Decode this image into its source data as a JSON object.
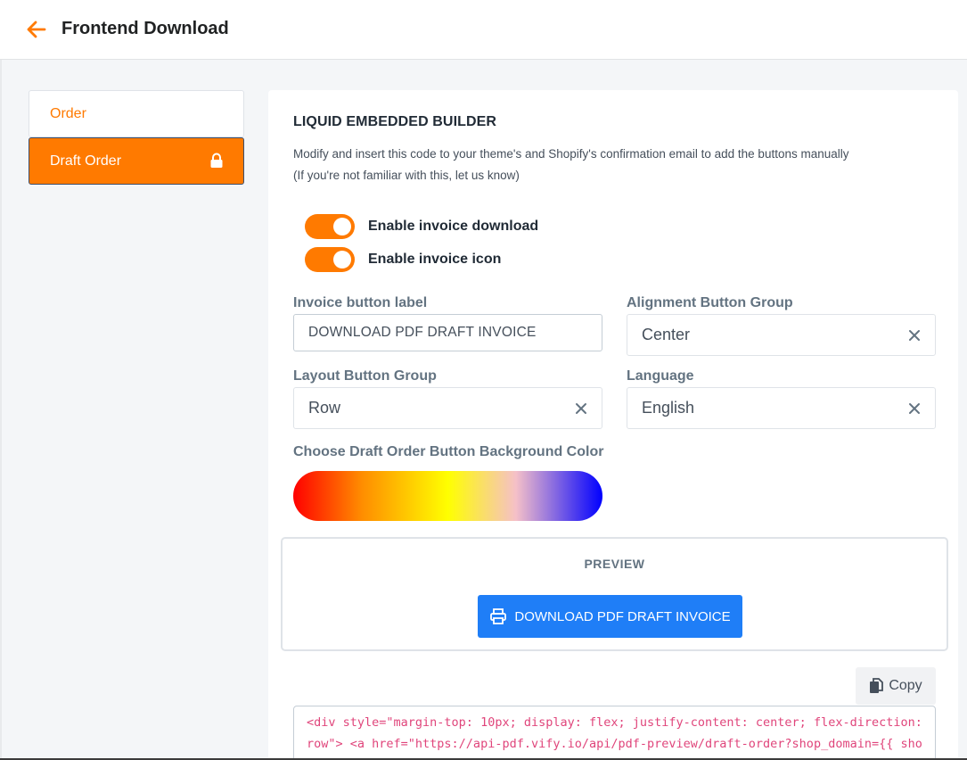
{
  "header": {
    "title": "Frontend Download"
  },
  "sidebar": {
    "items": [
      {
        "label": "Order"
      },
      {
        "label": "Draft Order"
      }
    ]
  },
  "main": {
    "title": "LIQUID EMBEDDED BUILDER",
    "desc_line1": "Modify and insert this code to your theme's and Shopify's confirmation email to add the buttons manually",
    "desc_line2": "(If you're not familiar with this, let us know)",
    "toggles": [
      {
        "label": "Enable invoice download",
        "on": true
      },
      {
        "label": "Enable invoice icon",
        "on": true
      }
    ],
    "invoice_label": {
      "label": "Invoice button label",
      "value": "DOWNLOAD PDF DRAFT INVOICE"
    },
    "alignment": {
      "label": "Alignment Button Group",
      "value": "Center"
    },
    "layout": {
      "label": "Layout Button Group",
      "value": "Row"
    },
    "language": {
      "label": "Language",
      "value": "English"
    },
    "color_label": "Choose Draft Order Button Background Color",
    "preview": {
      "title": "PREVIEW",
      "button_label": "DOWNLOAD PDF DRAFT INVOICE"
    },
    "copy_label": "Copy",
    "code": "<div style=\"margin-top: 10px; display: flex; justify-content: center; flex-direction: row\"> <a href=\"https://api-pdf.vify.io/api/pdf-preview/draft-order?shop_domain={{ shop.permanent_domain }}&draft_order_id={{ draft_order.id }}&lang=en\" style=\"background-color: #1f7ef7\">"
  },
  "colors": {
    "accent": "#ff7a00",
    "preview_button": "#1f7ef7",
    "code_text": "#e0457b"
  },
  "icons": {
    "back": "arrow-left-icon",
    "lock": "lock-icon",
    "clear": "close-icon",
    "printer": "printer-icon",
    "copy": "copy-icon"
  }
}
